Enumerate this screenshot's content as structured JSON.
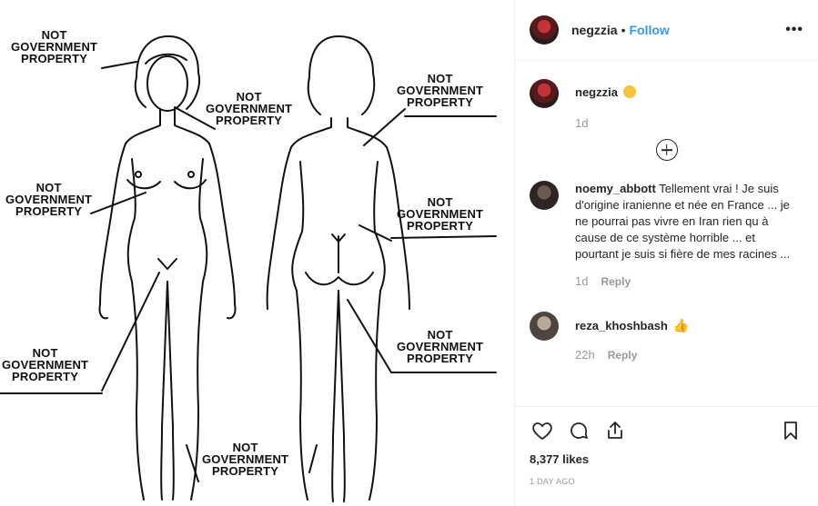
{
  "post": {
    "username": "negzzia",
    "follow_label": "Follow",
    "separator": "•",
    "more_label": "•••"
  },
  "image_labels": [
    [
      "NOT",
      "GOVERNMENT",
      "PROPERTY"
    ],
    [
      "NOT",
      "GOVERNMENT",
      "PROPERTY"
    ],
    [
      "NOT",
      "GOVERNMENT",
      "PROPERTY"
    ],
    [
      "NOT",
      "GOVERNMENT",
      "PROPERTY"
    ],
    [
      "NOT",
      "GOVERNMENT",
      "PROPERTY"
    ],
    [
      "NOT",
      "GOVERNMENT",
      "PROPERTY"
    ],
    [
      "NOT",
      "GOVERNMENT",
      "PROPERTY"
    ],
    [
      "NOT",
      "GOVERNMENT",
      "PROPERTY"
    ]
  ],
  "caption": {
    "user": "negzzia",
    "emoji": "smirk-emoji",
    "time": "1d"
  },
  "comments": [
    {
      "user": "noemy_abbott",
      "text": "Tellement vrai ! Je suis d'origine iranienne et née en France ... je ne pourrai pas vivre en Iran rien qu à cause de ce système horrible ... et pourtant je suis si fière de mes racines ...",
      "time": "1d",
      "reply": "Reply"
    },
    {
      "user": "reza_khoshbash",
      "emoji": "thumbs-up-emoji",
      "time": "22h",
      "reply": "Reply"
    }
  ],
  "likes": "8,377 likes",
  "posted": "1 DAY AGO",
  "icons": {
    "like": "heart-icon",
    "comment": "comment-icon",
    "share": "share-icon",
    "save": "bookmark-icon",
    "load_more": "plus-circle-icon"
  },
  "colors": {
    "link": "#3897f0",
    "muted": "#999999",
    "text": "#262626"
  }
}
